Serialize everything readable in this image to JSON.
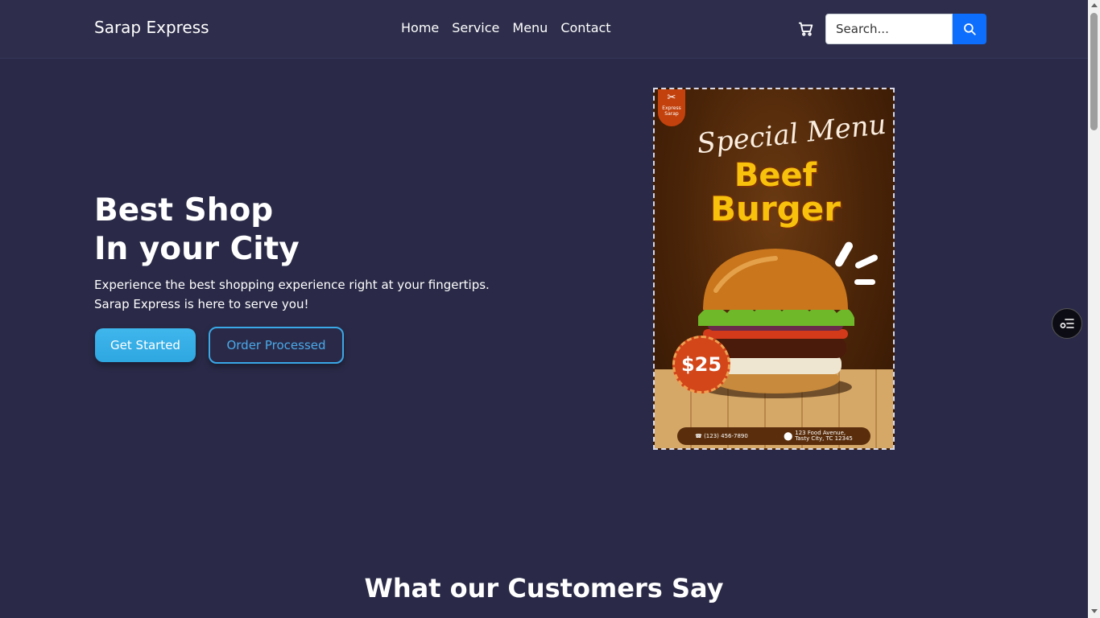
{
  "navbar": {
    "brand": "Sarap Express",
    "links": [
      "Home",
      "Service",
      "Menu",
      "Contact"
    ],
    "cart_icon": "cart-icon",
    "search_placeholder": "Search...",
    "search_icon": "search-icon"
  },
  "hero": {
    "title_line1": "Best Shop",
    "title_line2": "In your City",
    "desc_line1": "Experience the best shopping experience right at your fingertips.",
    "desc_line2": "Sarap Express is here to serve you!",
    "get_started": "Get Started",
    "order_processed": "Order Processed"
  },
  "poster": {
    "logo_line1": "Express",
    "logo_line2": "Sarap",
    "special": "Special Menu",
    "line1": "Beef",
    "line2": "Burger",
    "price": "$25",
    "phone": "(123) 456-7890",
    "address_line1": "123 Food Avenue,",
    "address_line2": "Tasty City, TC 12345"
  },
  "widget": {
    "icon": "settings-list-icon"
  },
  "section": {
    "title": "What our Customers Say"
  },
  "colors": {
    "background": "#2a2a48",
    "navbar": "#2e2e4c",
    "primary": "#0d6efd",
    "accent": "#3fb6ec"
  }
}
